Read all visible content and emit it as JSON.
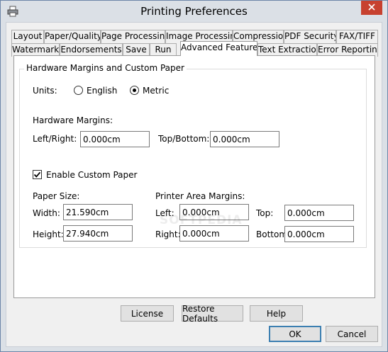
{
  "window": {
    "title": "Printing Preferences"
  },
  "icons": {
    "app": "printer-icon",
    "close": "close-icon"
  },
  "tabs": {
    "row1": [
      "Layout",
      "Paper/Quality",
      "Page Processing",
      "Image Processing",
      "Compression",
      "PDF Security",
      "FAX/TIFF"
    ],
    "row2": [
      "Watermark",
      "Endorsements",
      "Save",
      "Run",
      "Advanced Features",
      "Text Extraction",
      "Error Reporting"
    ],
    "active": "Advanced Features"
  },
  "group": {
    "title": "Hardware Margins and Custom Paper"
  },
  "units": {
    "label": "Units:",
    "english": "English",
    "metric": "Metric",
    "selected": "Metric"
  },
  "hardware_margins": {
    "title": "Hardware Margins:",
    "left_right_label": "Left/Right:",
    "left_right_value": "0.000cm",
    "top_bottom_label": "Top/Bottom:",
    "top_bottom_value": "0.000cm"
  },
  "custom_paper": {
    "label": "Enable Custom Paper",
    "checked": true
  },
  "paper_size": {
    "title": "Paper Size:",
    "width_label": "Width:",
    "width_value": "21.590cm",
    "height_label": "Height:",
    "height_value": "27.940cm"
  },
  "printer_area": {
    "title": "Printer Area Margins:",
    "left_label": "Left:",
    "left_value": "0.000cm",
    "right_label": "Right:",
    "right_value": "0.000cm",
    "top_label": "Top:",
    "top_value": "0.000cm",
    "bottom_label": "Bottom:",
    "bottom_value": "0.000cm"
  },
  "buttons": {
    "license": "License",
    "restore": "Restore Defaults",
    "help": "Help",
    "ok": "OK",
    "cancel": "Cancel"
  },
  "watermark": "SOFTPEDIA"
}
